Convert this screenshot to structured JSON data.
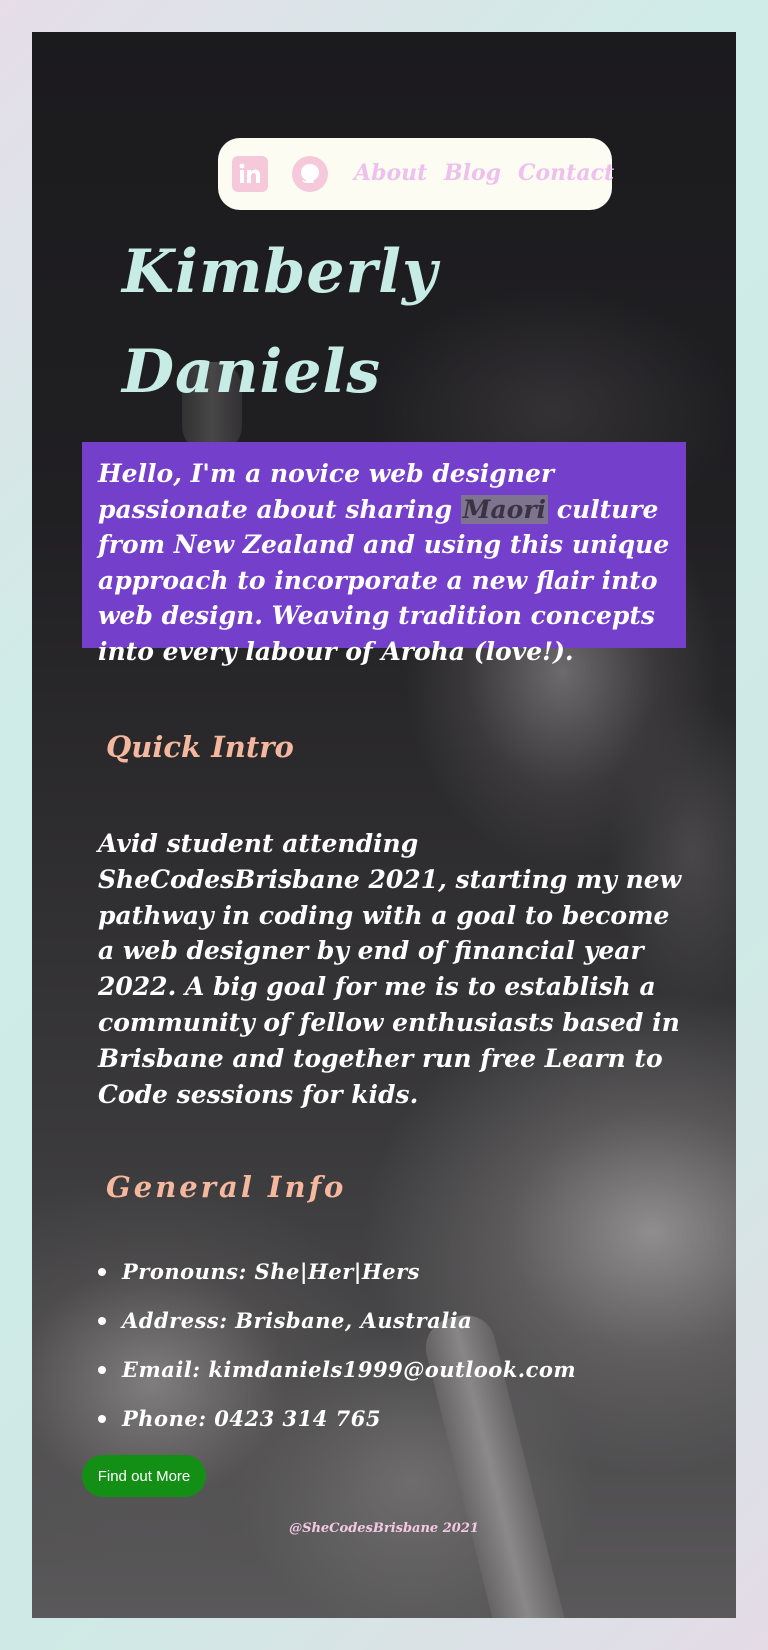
{
  "nav": {
    "icons": [
      "linkedin-icon",
      "github-icon"
    ],
    "about": "About",
    "blog": "Blog",
    "contact": "Contact"
  },
  "header": {
    "first_name": "Kimberly",
    "last_name": "Daniels"
  },
  "hello": {
    "before": "Hello, I'm a novice web designer passionate about sharing ",
    "highlight": "Maori",
    "after": " culture from New Zealand and using this unique approach to incorporate a new flair into web design. Weaving tradition concepts into every labour of Aroha (love!)."
  },
  "quick_intro": {
    "heading": "Quick Intro",
    "text": "Avid student attending SheCodesBrisbane 2021, starting my new pathway in coding with a goal to become a web designer by end of financial year 2022. A big goal for me is to establish a community of fellow enthusiasts based in Brisbane and together run free Learn to Code sessions for kids."
  },
  "general_info": {
    "heading": "General Info",
    "items": [
      "Pronouns: She|Her|Hers",
      "Address: Brisbane, Australia",
      "Email: kimdaniels1999@outlook.com",
      "Phone: 0423 314 765"
    ]
  },
  "cta": {
    "label": "Find out More"
  },
  "footer": {
    "text": "@SheCodesBrisbane 2021"
  },
  "colors": {
    "nav_bg": "#fdfcf3",
    "nav_link": "#edc0ee",
    "icon_bg": "#f5c9d9",
    "title": "#c7ece5",
    "hello_bg": "#743fca",
    "heading": "#f5b79d",
    "button": "#138f16"
  }
}
